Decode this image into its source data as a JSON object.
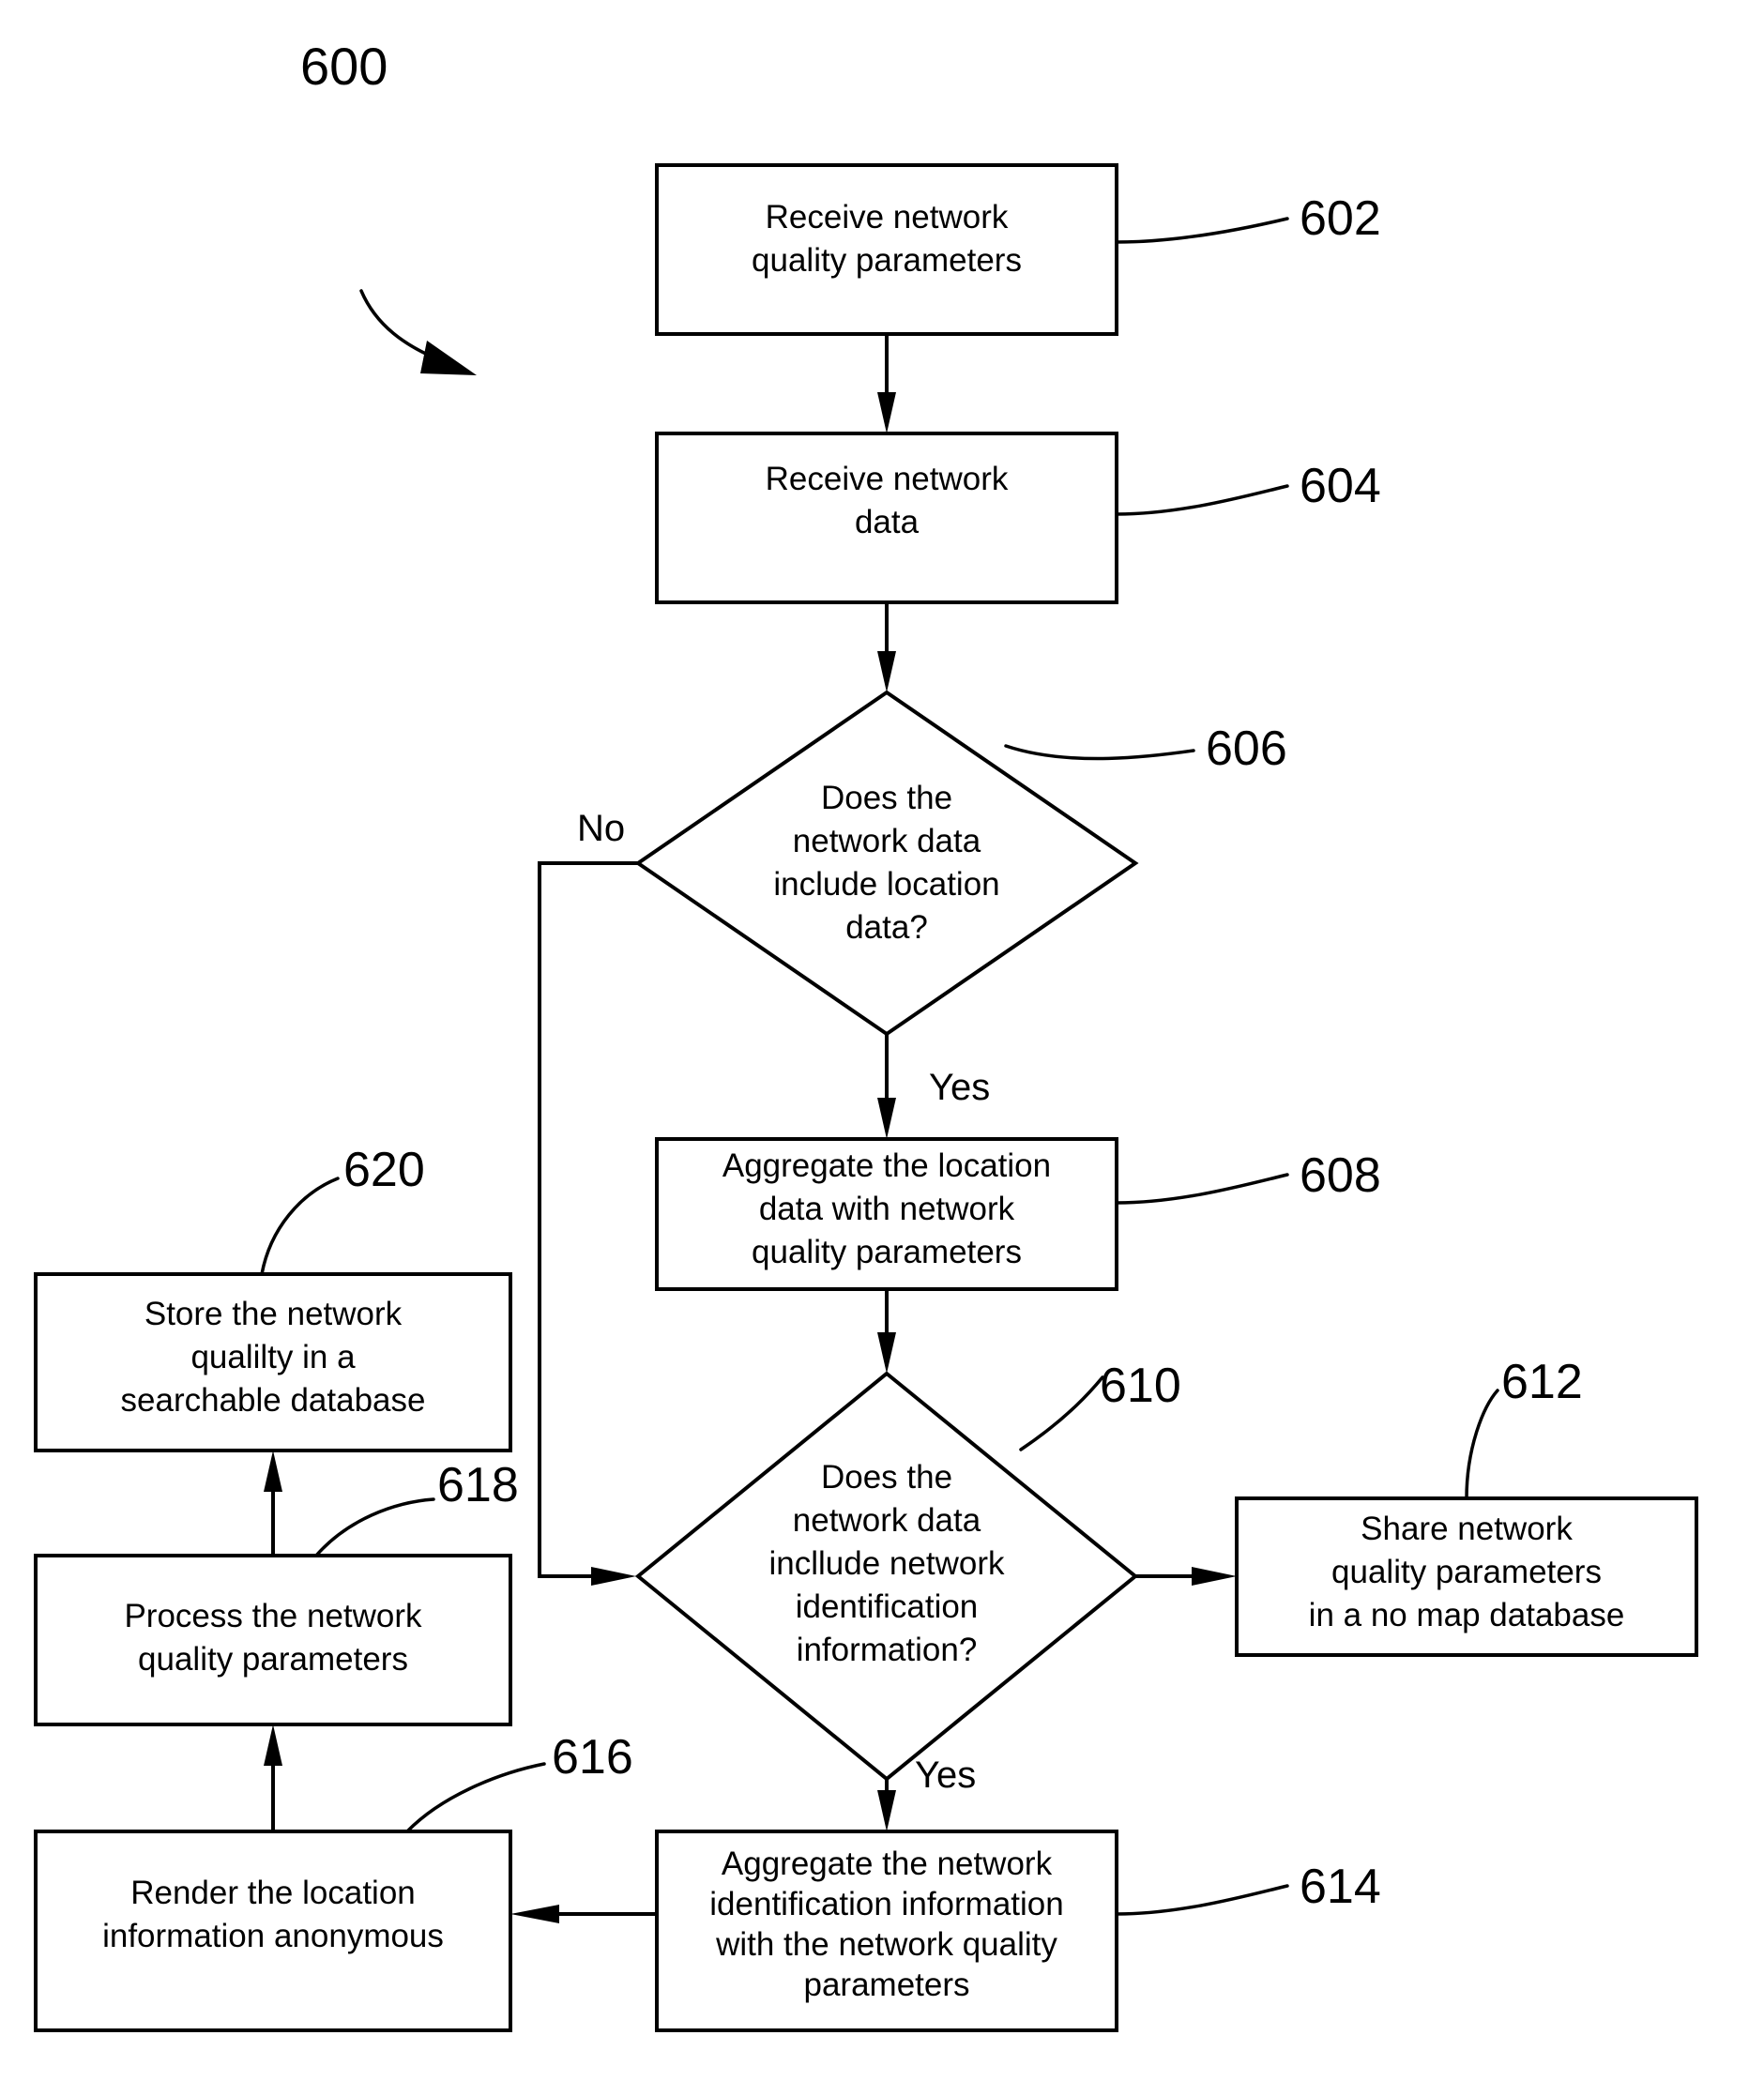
{
  "figure": {
    "number": "600",
    "type": "patent-flowchart"
  },
  "nodes": [
    {
      "id": "602",
      "shape": "process",
      "ref": "602",
      "lines": [
        "Receive network",
        "quality parameters"
      ]
    },
    {
      "id": "604",
      "shape": "process",
      "ref": "604",
      "lines": [
        "Receive network",
        "data"
      ]
    },
    {
      "id": "606",
      "shape": "decision",
      "ref": "606",
      "lines": [
        "Does the",
        "network data",
        "include location",
        "data?"
      ]
    },
    {
      "id": "608",
      "shape": "process",
      "ref": "608",
      "lines": [
        "Aggregate the location",
        "data with network",
        "quality parameters"
      ]
    },
    {
      "id": "610",
      "shape": "decision",
      "ref": "610",
      "lines": [
        "Does the",
        "network data",
        "incllude network",
        "identification",
        "information?"
      ]
    },
    {
      "id": "612",
      "shape": "process",
      "ref": "612",
      "lines": [
        "Share network",
        "quality parameters",
        "in a no map database"
      ]
    },
    {
      "id": "614",
      "shape": "process",
      "ref": "614",
      "lines": [
        "Aggregate the network",
        "identification information",
        "with the network quality",
        "parameters"
      ]
    },
    {
      "id": "616",
      "shape": "process",
      "ref": "616",
      "lines": [
        "Render the location",
        "information anonymous"
      ]
    },
    {
      "id": "618",
      "shape": "process",
      "ref": "618",
      "lines": [
        "Process the network",
        "quality parameters"
      ]
    },
    {
      "id": "620",
      "shape": "process",
      "ref": "620",
      "lines": [
        "Store the network",
        "qualilty in a",
        "searchable database"
      ]
    }
  ],
  "edge_labels": {
    "no_606": "No",
    "yes_606": "Yes",
    "yes_610": "Yes"
  },
  "colors": {
    "stroke": "#000000",
    "fill": "#ffffff"
  }
}
